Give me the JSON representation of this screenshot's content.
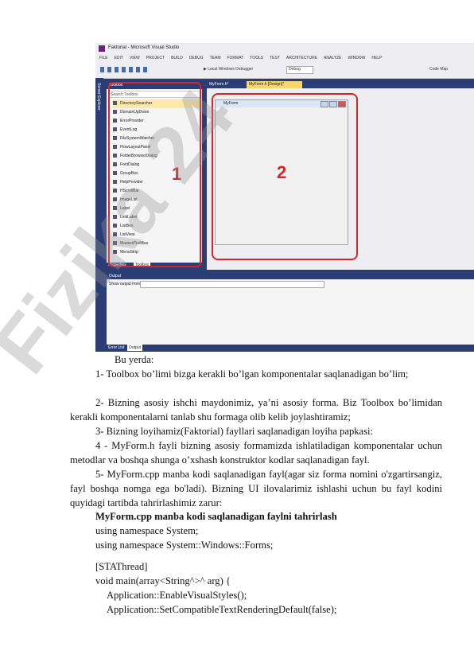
{
  "screenshot": {
    "window_title": "Faktorial - Microsoft Visual Studio",
    "menu": [
      "FILE",
      "EDIT",
      "VIEW",
      "PROJECT",
      "BUILD",
      "DEBUG",
      "TEAM",
      "FORMAT",
      "TOOLS",
      "TEST",
      "ARCHITECTURE",
      "ANALYZE",
      "WINDOW",
      "HELP"
    ],
    "toolbar_debugger": "Local Windows Debugger",
    "toolbar_config": "Debug",
    "toolbar_codemap": "Code Map",
    "server_explorer": "Server Explorer",
    "toolbox_title": "Toolbox",
    "toolbox_search": "Search Toolbox",
    "toolbox_items": [
      "DirectorySearcher",
      "DomainUpDown",
      "ErrorProvider",
      "EventLog",
      "FileSystemWatcher",
      "FlowLayoutPanel",
      "FolderBrowserDialog",
      "FontDialog",
      "GroupBox",
      "HelpProvider",
      "HScrollBar",
      "ImageList",
      "Label",
      "LinkLabel",
      "ListBox",
      "ListView",
      "MaskedTextBox",
      "MenuStrip"
    ],
    "toolbox_tab_properties": "Properties",
    "toolbox_tab_toolbox": "Toolbox",
    "tab_h": "MyForm.h*",
    "tab_design": "MyForm.h [Design]*",
    "form_title": "MyForm",
    "label_1": "1",
    "label_2": "2",
    "output_title": "Output",
    "output_show": "Show output from:",
    "output_tab_errors": "Error List",
    "output_tab_output": "Output"
  },
  "caption": "Bu yerda:",
  "paragraphs": [
    {
      "first": "1- Toolbox bo’limi bizga kerakli bo’lgan komponentalar saqlanadigan",
      "rest": "bo’lim;"
    },
    {
      "first": "2- Bizning asosiy ishchi maydonimiz, ya’ni asosiy forma. Biz Toolbox",
      "rest": "bo’limidan kerakli komponentalarni tanlab shu formaga olib kelib joylashtiramiz;"
    },
    {
      "first": "3- Bizning loyihamiz(Faktorial) fayllari saqlanadigan  loyiha papkasi:",
      "rest": ""
    },
    {
      "first": "4 - MyForm.h fayli bizning asosiy formamizda ishlatiladigan komponentalar",
      "rest": "uchun metodlar va boshqa shunga o’xshash konstruktor kodlar saqlanadigan fayl."
    },
    {
      "first": "5- MyForm.cpp manba kodi saqlanadigan fayl(agar siz forma nomini",
      "rest": "o'zgartirsangiz, fayl boshqa nomga ega bo'ladi). Bizning UI ilovalarimiz ishlashi",
      "rest2": "uchun bu fayl kodini quyidagi tartibda tahrirlashimiz zarur:"
    }
  ],
  "heading": "MyForm.cpp manba kodi saqlanadigan faylni tahrirlash",
  "code": [
    "using namespace System;",
    "using namespace System::Windows::Forms;",
    "",
    "[STAThread]",
    "void main(array<String^>^ arg) {",
    "    Application::EnableVisualStyles();",
    "    Application::SetCompatibleTextRenderingDefault(false);"
  ],
  "watermark": "Fizika 24"
}
